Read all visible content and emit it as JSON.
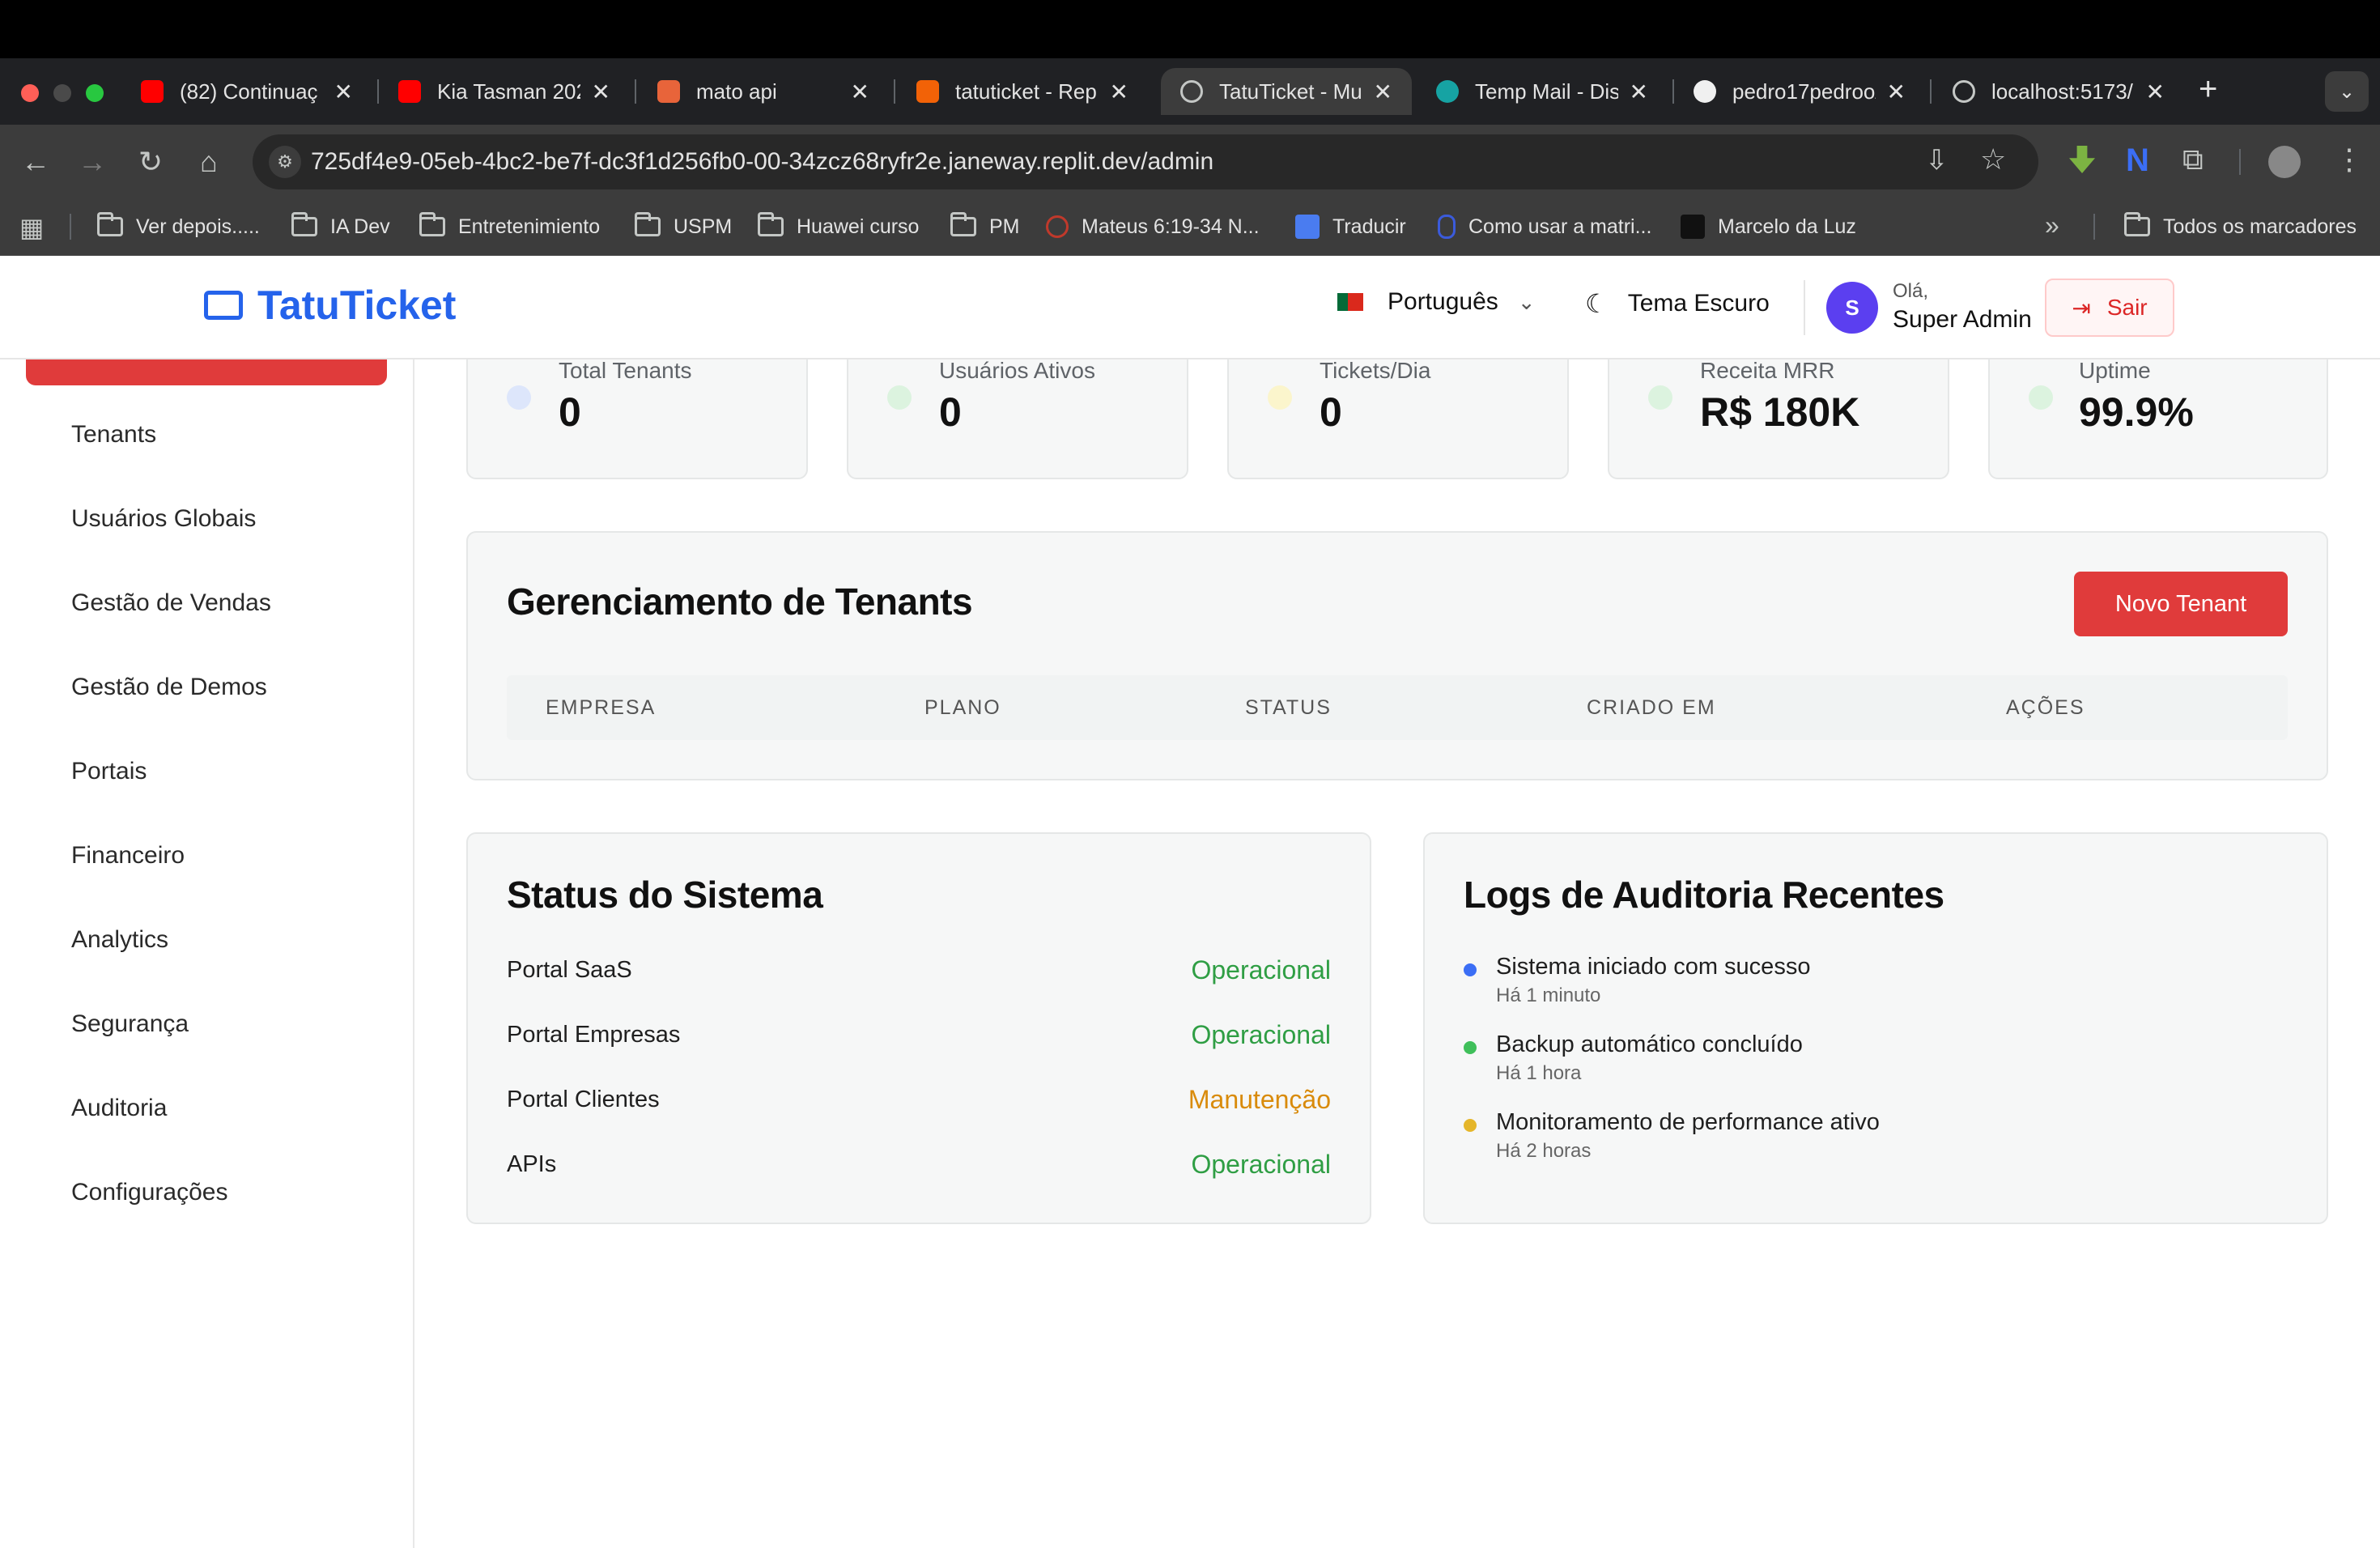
{
  "browser": {
    "tabs": [
      {
        "title": "(82) Continuaç",
        "favicon": "youtube-icon"
      },
      {
        "title": "Kia Tasman 202",
        "favicon": "youtube-icon"
      },
      {
        "title": "mato api",
        "favicon": "app-icon"
      },
      {
        "title": "tatuticket - Rep",
        "favicon": "replit-icon"
      },
      {
        "title": "TatuTicket - Mu",
        "favicon": "globe-icon",
        "active": true
      },
      {
        "title": "Temp Mail - Dis",
        "favicon": "mail-icon"
      },
      {
        "title": "pedro17pedroo/",
        "favicon": "github-icon"
      },
      {
        "title": "localhost:5173/",
        "favicon": "globe-icon"
      }
    ],
    "new_tab": "+",
    "url": "725df4e9-05eb-4bc2-be7f-dc3f1d256fb0-00-34zcz68ryfr2e.janeway.replit.dev/admin",
    "bookmarks": [
      {
        "label": "Ver depois.....",
        "type": "folder"
      },
      {
        "label": "IA Dev",
        "type": "folder"
      },
      {
        "label": "Entretenimiento",
        "type": "folder"
      },
      {
        "label": "USPM",
        "type": "folder"
      },
      {
        "label": "Huawei curso",
        "type": "folder"
      },
      {
        "label": "PM",
        "type": "folder"
      },
      {
        "label": "Mateus 6:19-34 N...",
        "type": "link"
      },
      {
        "label": "Traducir",
        "type": "link"
      },
      {
        "label": "Como usar a matri...",
        "type": "link"
      },
      {
        "label": "Marcelo da Luz",
        "type": "link"
      }
    ],
    "all_bookmarks": "Todos os marcadores"
  },
  "header": {
    "brand": "TatuTicket",
    "language": "Português",
    "theme": "Tema Escuro",
    "greeting": "Olá,",
    "user": "Super Admin",
    "avatar_letter": "S",
    "logout": "Sair"
  },
  "sidebar": {
    "items": [
      {
        "label": "Tenants"
      },
      {
        "label": "Usuários Globais"
      },
      {
        "label": "Gestão de Vendas"
      },
      {
        "label": "Gestão de Demos"
      },
      {
        "label": "Portais"
      },
      {
        "label": "Financeiro"
      },
      {
        "label": "Analytics"
      },
      {
        "label": "Segurança"
      },
      {
        "label": "Auditoria"
      },
      {
        "label": "Configurações"
      }
    ]
  },
  "stats": [
    {
      "label": "Total Tenants",
      "value": "0",
      "dot_color": "#dde6fb"
    },
    {
      "label": "Usuários Ativos",
      "value": "0",
      "dot_color": "#dcf3df"
    },
    {
      "label": "Tickets/Dia",
      "value": "0",
      "dot_color": "#fbf5cc"
    },
    {
      "label": "Receita MRR",
      "value": "R$ 180K",
      "dot_color": "#dcf3df"
    },
    {
      "label": "Uptime",
      "value": "99.9%",
      "dot_color": "#dcf3df"
    }
  ],
  "tenants": {
    "title": "Gerenciamento de Tenants",
    "new_button": "Novo Tenant",
    "columns": [
      "EMPRESA",
      "PLANO",
      "STATUS",
      "CRIADO EM",
      "AÇÕES"
    ]
  },
  "system_status": {
    "title": "Status do Sistema",
    "items": [
      {
        "name": "Portal SaaS",
        "status": "Operacional",
        "color": "#2f9e44"
      },
      {
        "name": "Portal Empresas",
        "status": "Operacional",
        "color": "#2f9e44"
      },
      {
        "name": "Portal Clientes",
        "status": "Manutenção",
        "color": "#d98b0b"
      },
      {
        "name": "APIs",
        "status": "Operacional",
        "color": "#2f9e44"
      }
    ]
  },
  "audit_logs": {
    "title": "Logs de Auditoria Recentes",
    "items": [
      {
        "text": "Sistema iniciado com sucesso",
        "time": "Há 1 minuto",
        "color": "#3b6ef5"
      },
      {
        "text": "Backup automático concluído",
        "time": "Há 1 hora",
        "color": "#3fbf5a"
      },
      {
        "text": "Monitoramento de performance ativo",
        "time": "Há 2 horas",
        "color": "#e5b62a"
      }
    ]
  }
}
